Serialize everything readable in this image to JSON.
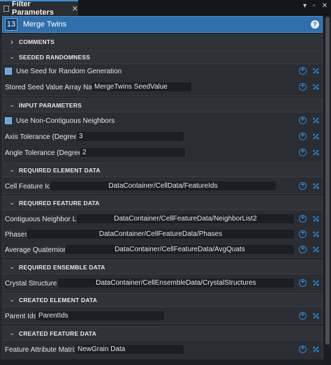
{
  "window": {
    "tab_title": "Filter Parameters",
    "tab_close": "✕",
    "ctrl_menu": "▾",
    "ctrl_restore": "▫",
    "ctrl_close": "✕"
  },
  "filter": {
    "index": "13",
    "name": "Merge Twins",
    "help": "?"
  },
  "icons": {
    "chevron_collapsed": "›",
    "chevron_expanded": "⌄",
    "add": "+",
    "add_icon_color": "#2f88d8",
    "accent_color": "#2f6fab"
  },
  "groups": {
    "comments": {
      "title": "COMMENTS"
    },
    "seeded": {
      "title": "SEEDED RANDOMNESS",
      "use_seed_label": "Use Seed for Random Generation",
      "stored_seed_label": "Stored Seed Value Array Name",
      "stored_seed_value": "MergeTwins SeedValue"
    },
    "input": {
      "title": "INPUT PARAMETERS",
      "non_contiguous_label": "Use Non-Contiguous Neighbors",
      "axis_tol_label": "Axis Tolerance (Degrees)",
      "axis_tol_value": "3",
      "angle_tol_label": "Angle Tolerance (Degrees)",
      "angle_tol_value": "2"
    },
    "req_element": {
      "title": "REQUIRED ELEMENT DATA",
      "cell_feature_ids_label": "Cell Feature Ids",
      "cell_feature_ids_value": "DataContainer/CellData/FeatureIds"
    },
    "req_feature": {
      "title": "REQUIRED FEATURE DATA",
      "contig_label": "Contiguous Neighbor List",
      "contig_value": "DataContainer/CellFeatureData/NeighborList2",
      "phases_label": "Phases",
      "phases_value": "DataContainer/CellFeatureData/Phases",
      "avgq_label": "Average Quaternions",
      "avgq_value": "DataContainer/CellFeatureData/AvgQuats"
    },
    "req_ensemble": {
      "title": "REQUIRED ENSEMBLE DATA",
      "crystal_label": "Crystal Structures",
      "crystal_value": "DataContainer/CellEnsembleData/CrystalStructures"
    },
    "created_element": {
      "title": "CREATED ELEMENT DATA",
      "parent_ids_label": "Parent Ids",
      "parent_ids_value": "ParentIds"
    },
    "created_feature": {
      "title": "CREATED FEATURE DATA",
      "fam_label": "Feature Attribute Matrix",
      "fam_value": "NewGrain Data"
    }
  }
}
